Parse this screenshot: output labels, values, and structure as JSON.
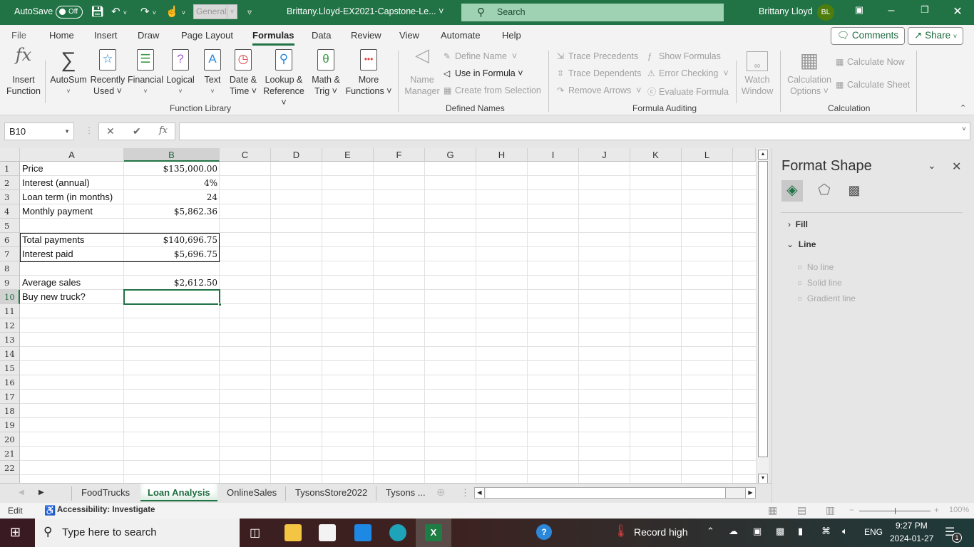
{
  "titlebar": {
    "autosave_label": "AutoSave",
    "autosave_state": "Off",
    "number_format": "General",
    "document_title": "Brittany.Lloyd-EX2021-Capstone-Le...",
    "search_label": "Search",
    "user_name": "Brittany Lloyd",
    "user_initials": "BL"
  },
  "ribbon_tabs": [
    "File",
    "Home",
    "Insert",
    "Draw",
    "Page Layout",
    "Formulas",
    "Data",
    "Review",
    "View",
    "Automate",
    "Help"
  ],
  "active_tab": "Formulas",
  "top_buttons": {
    "comments": "Comments",
    "share": "Share"
  },
  "ribbon": {
    "function_library": {
      "label": "Function Library",
      "buttons": [
        {
          "line1": "Insert",
          "line2": "Function"
        },
        {
          "line1": "AutoSum",
          "line2": "˅"
        },
        {
          "line1": "Recently",
          "line2": "Used ˅"
        },
        {
          "line1": "Financial",
          "line2": "˅"
        },
        {
          "line1": "Logical",
          "line2": "˅"
        },
        {
          "line1": "Text",
          "line2": "˅"
        },
        {
          "line1": "Date &",
          "line2": "Time ˅"
        },
        {
          "line1": "Lookup &",
          "line2": "Reference ˅"
        },
        {
          "line1": "Math &",
          "line2": "Trig ˅"
        },
        {
          "line1": "More",
          "line2": "Functions ˅"
        }
      ]
    },
    "defined_names": {
      "label": "Defined Names",
      "name_manager": {
        "line1": "Name",
        "line2": "Manager"
      },
      "define_name": "Define Name",
      "use_in_formula": "Use in Formula",
      "create_from_selection": "Create from Selection"
    },
    "formula_auditing": {
      "label": "Formula Auditing",
      "trace_precedents": "Trace Precedents",
      "trace_dependents": "Trace Dependents",
      "remove_arrows": "Remove Arrows",
      "show_formulas": "Show Formulas",
      "error_checking": "Error Checking",
      "evaluate_formula": "Evaluate Formula",
      "watch_window": {
        "line1": "Watch",
        "line2": "Window"
      }
    },
    "calculation": {
      "label": "Calculation",
      "options": {
        "line1": "Calculation",
        "line2": "Options ˅"
      },
      "calculate_now": "Calculate Now",
      "calculate_sheet": "Calculate Sheet"
    }
  },
  "formula_bar": {
    "name_box": "B10",
    "formula": ""
  },
  "columns": [
    "A",
    "B",
    "C",
    "D",
    "E",
    "F",
    "G",
    "H",
    "I",
    "J",
    "K",
    "L"
  ],
  "selected_column": "B",
  "row_numbers": [
    "1",
    "2",
    "3",
    "4",
    "5",
    "6",
    "7",
    "8",
    "9",
    "10",
    "11",
    "12",
    "13",
    "14",
    "15",
    "16",
    "17",
    "18",
    "19",
    "20",
    "21",
    "22"
  ],
  "selected_row": "10",
  "cells": {
    "A1": "Price",
    "B1": "$135,000.00",
    "A2": "Interest (annual)",
    "B2": "4%",
    "A3": "Loan term (in months)",
    "B3": "24",
    "A4": "Monthly payment",
    "B4": "$5,862.36",
    "A6": "Total payments",
    "B6": "$140,696.75",
    "A7": "Interest paid",
    "B7": "$5,696.75",
    "A9": "Average sales",
    "B9": "$2,612.50",
    "A10": "Buy new truck?",
    "B10": ""
  },
  "format_pane": {
    "title": "Format Shape",
    "sections": {
      "fill": "Fill",
      "line": "Line"
    },
    "line_options": [
      "No line",
      "Solid line",
      "Gradient line"
    ]
  },
  "sheet_tabs": [
    "FoodTrucks",
    "Loan Analysis",
    "OnlineSales",
    "TysonsStore2022",
    "Tysons ..."
  ],
  "active_sheet": "Loan Analysis",
  "status_bar": {
    "mode": "Edit",
    "accessibility": "Accessibility: Investigate",
    "zoom": "100%"
  },
  "taskbar": {
    "search_placeholder": "Type here to search",
    "weather": "Record high",
    "language": "ENG",
    "time": "9:27 PM",
    "date": "2024-01-27",
    "notification_count": "1"
  }
}
